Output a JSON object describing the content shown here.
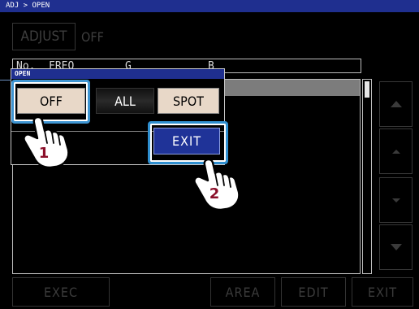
{
  "topbar": {
    "breadcrumb": "ADJ > OPEN"
  },
  "adjust": {
    "button_label": "ADJUST",
    "value": "OFF"
  },
  "table": {
    "headers": [
      "No.",
      "FREQ",
      "G",
      "B"
    ]
  },
  "popup": {
    "title": "OPEN",
    "options": [
      "OFF",
      "ALL",
      "SPOT"
    ],
    "exit_label": "EXIT"
  },
  "bottom_bar": {
    "exec_label": "EXEC",
    "area_label": "AREA",
    "edit_label": "EDIT",
    "exit_label": "EXIT"
  },
  "callouts": {
    "step1": "1",
    "step2": "2"
  },
  "colors": {
    "title_bar": "#1f2f8f",
    "frame": "#2f8fd0",
    "step_number": "#8b0f2a",
    "option_selected": "#e8d8c8"
  },
  "icons": [
    "scroll-up-icon",
    "page-up-icon",
    "page-down-icon",
    "scroll-down-icon",
    "pointing-hand-icon"
  ]
}
